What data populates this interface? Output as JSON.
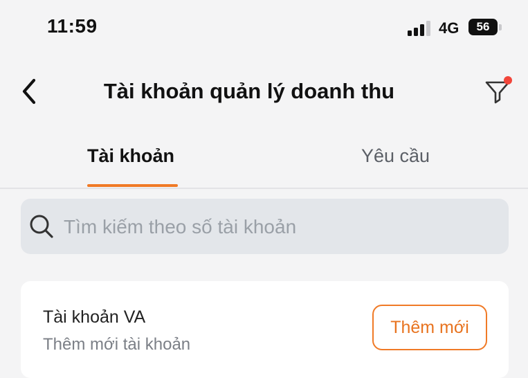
{
  "status_bar": {
    "time": "11:59",
    "network": "4G",
    "battery": "56"
  },
  "header": {
    "title": "Tài khoản quản lý doanh thu",
    "back_icon": "chevron-left-icon",
    "filter_icon": "filter-icon",
    "filter_badge_color": "#f2453a"
  },
  "tabs": [
    {
      "label": "Tài khoản",
      "active": true
    },
    {
      "label": "Yêu cầu",
      "active": false
    }
  ],
  "search": {
    "placeholder": "Tìm kiếm theo số tài khoản",
    "value": ""
  },
  "account_card": {
    "title": "Tài khoản VA",
    "subtitle": "Thêm mới tài khoản",
    "add_button_label": "Thêm mới"
  },
  "colors": {
    "accent": "#f07a26",
    "background": "#f4f4f5",
    "search_bg": "#e3e6ea"
  }
}
